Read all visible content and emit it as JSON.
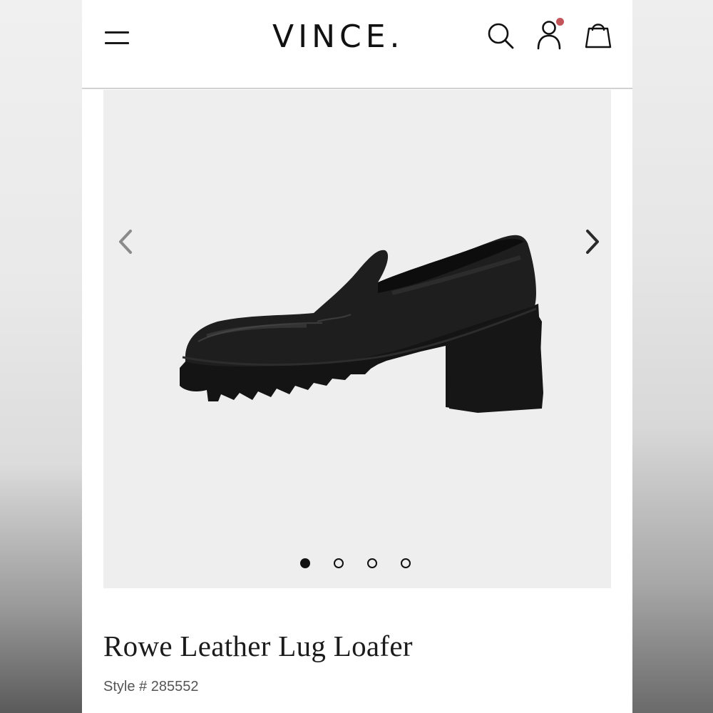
{
  "header": {
    "brand": "VINCE.",
    "menu_icon": "hamburger-menu-icon",
    "search_icon": "search-icon",
    "account_icon": "account-icon",
    "bag_icon": "shopping-bag-icon",
    "notification_color": "#c2555a"
  },
  "gallery": {
    "prev_icon": "chevron-left-icon",
    "next_icon": "chevron-right-icon",
    "image_subject": "black leather lug loafer shoe",
    "background_color": "#efeeef",
    "slide_count": 4,
    "active_slide": 1
  },
  "product": {
    "title": "Rowe Leather Lug Loafer",
    "style_label": "Style # 285552"
  }
}
